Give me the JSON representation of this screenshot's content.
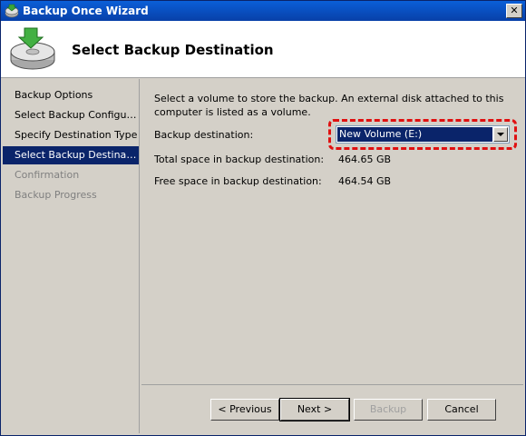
{
  "window": {
    "title": "Backup Once Wizard",
    "close_glyph": "✕"
  },
  "header": {
    "title": "Select Backup Destination",
    "icon": "backup-disk-icon"
  },
  "sidebar": {
    "items": [
      {
        "label": "Backup Options",
        "state": "normal"
      },
      {
        "label": "Select Backup Configur...",
        "state": "normal"
      },
      {
        "label": "Specify Destination Type",
        "state": "normal"
      },
      {
        "label": "Select Backup Destination",
        "state": "active"
      },
      {
        "label": "Confirmation",
        "state": "disabled"
      },
      {
        "label": "Backup Progress",
        "state": "disabled"
      }
    ]
  },
  "main": {
    "description": "Select a volume to store the backup. An external disk attached to this computer is listed as a volume.",
    "destination_label": "Backup destination:",
    "destination_value": "New Volume (E:)",
    "total_space_label": "Total space in backup destination:",
    "total_space_value": "464.65 GB",
    "free_space_label": "Free space in backup destination:",
    "free_space_value": "464.54 GB"
  },
  "buttons": {
    "previous": "< Previous",
    "next": "Next >",
    "backup": "Backup",
    "cancel": "Cancel"
  },
  "colors": {
    "active_item": "#0a246a",
    "highlight": "#e01010",
    "titlebar": "#0a5fd8"
  }
}
